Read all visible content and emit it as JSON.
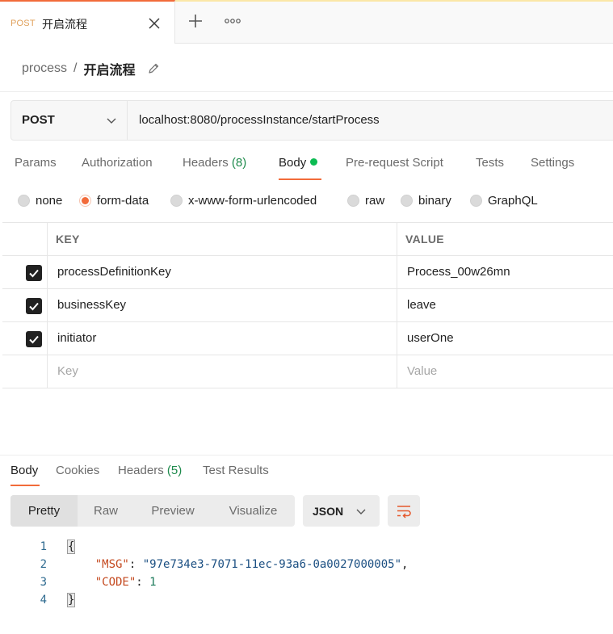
{
  "tab": {
    "method": "POST",
    "title": "开启流程"
  },
  "breadcrumb": {
    "collection": "process",
    "separator": "/",
    "request": "开启流程"
  },
  "request": {
    "method": "POST",
    "url": "localhost:8080/processInstance/startProcess"
  },
  "request_tabs": [
    {
      "label": "Params"
    },
    {
      "label": "Authorization"
    },
    {
      "label": "Headers",
      "count": "(8)"
    },
    {
      "label": "Body",
      "active": true
    },
    {
      "label": "Pre-request Script"
    },
    {
      "label": "Tests"
    },
    {
      "label": "Settings"
    }
  ],
  "body_types": [
    "none",
    "form-data",
    "x-www-form-urlencoded",
    "raw",
    "binary",
    "GraphQL"
  ],
  "body_type_selected": "form-data",
  "table": {
    "key_header": "KEY",
    "value_header": "VALUE",
    "rows": [
      {
        "key": "processDefinitionKey",
        "value": "Process_00w26mn",
        "checked": true
      },
      {
        "key": "businessKey",
        "value": "leave",
        "checked": true
      },
      {
        "key": "initiator",
        "value": "userOne",
        "checked": true
      }
    ],
    "key_placeholder": "Key",
    "value_placeholder": "Value"
  },
  "response_tabs": [
    {
      "label": "Body",
      "active": true
    },
    {
      "label": "Cookies"
    },
    {
      "label": "Headers",
      "count": "(5)"
    },
    {
      "label": "Test Results"
    }
  ],
  "view_modes": [
    "Pretty",
    "Raw",
    "Preview",
    "Visualize"
  ],
  "view_selected": "Pretty",
  "format": "JSON",
  "code": {
    "line_numbers": [
      "1",
      "2",
      "3",
      "4"
    ],
    "open_brace": "{",
    "close_brace": "}",
    "msg_key": "\"MSG\"",
    "msg_value": "\"97e734e3-7071-11ec-93a6-0a0027000005\"",
    "code_key": "\"CODE\"",
    "code_value": "1"
  },
  "colors": {
    "accent": "#f26b3a",
    "active_dot": "#0cbb52",
    "count_green": "#1e8a4c"
  },
  "icons": [
    "close-icon",
    "plus-icon",
    "more-icon",
    "edit-icon",
    "chevron-down-icon",
    "checkbox-checked-icon",
    "wrap-lines-icon"
  ]
}
